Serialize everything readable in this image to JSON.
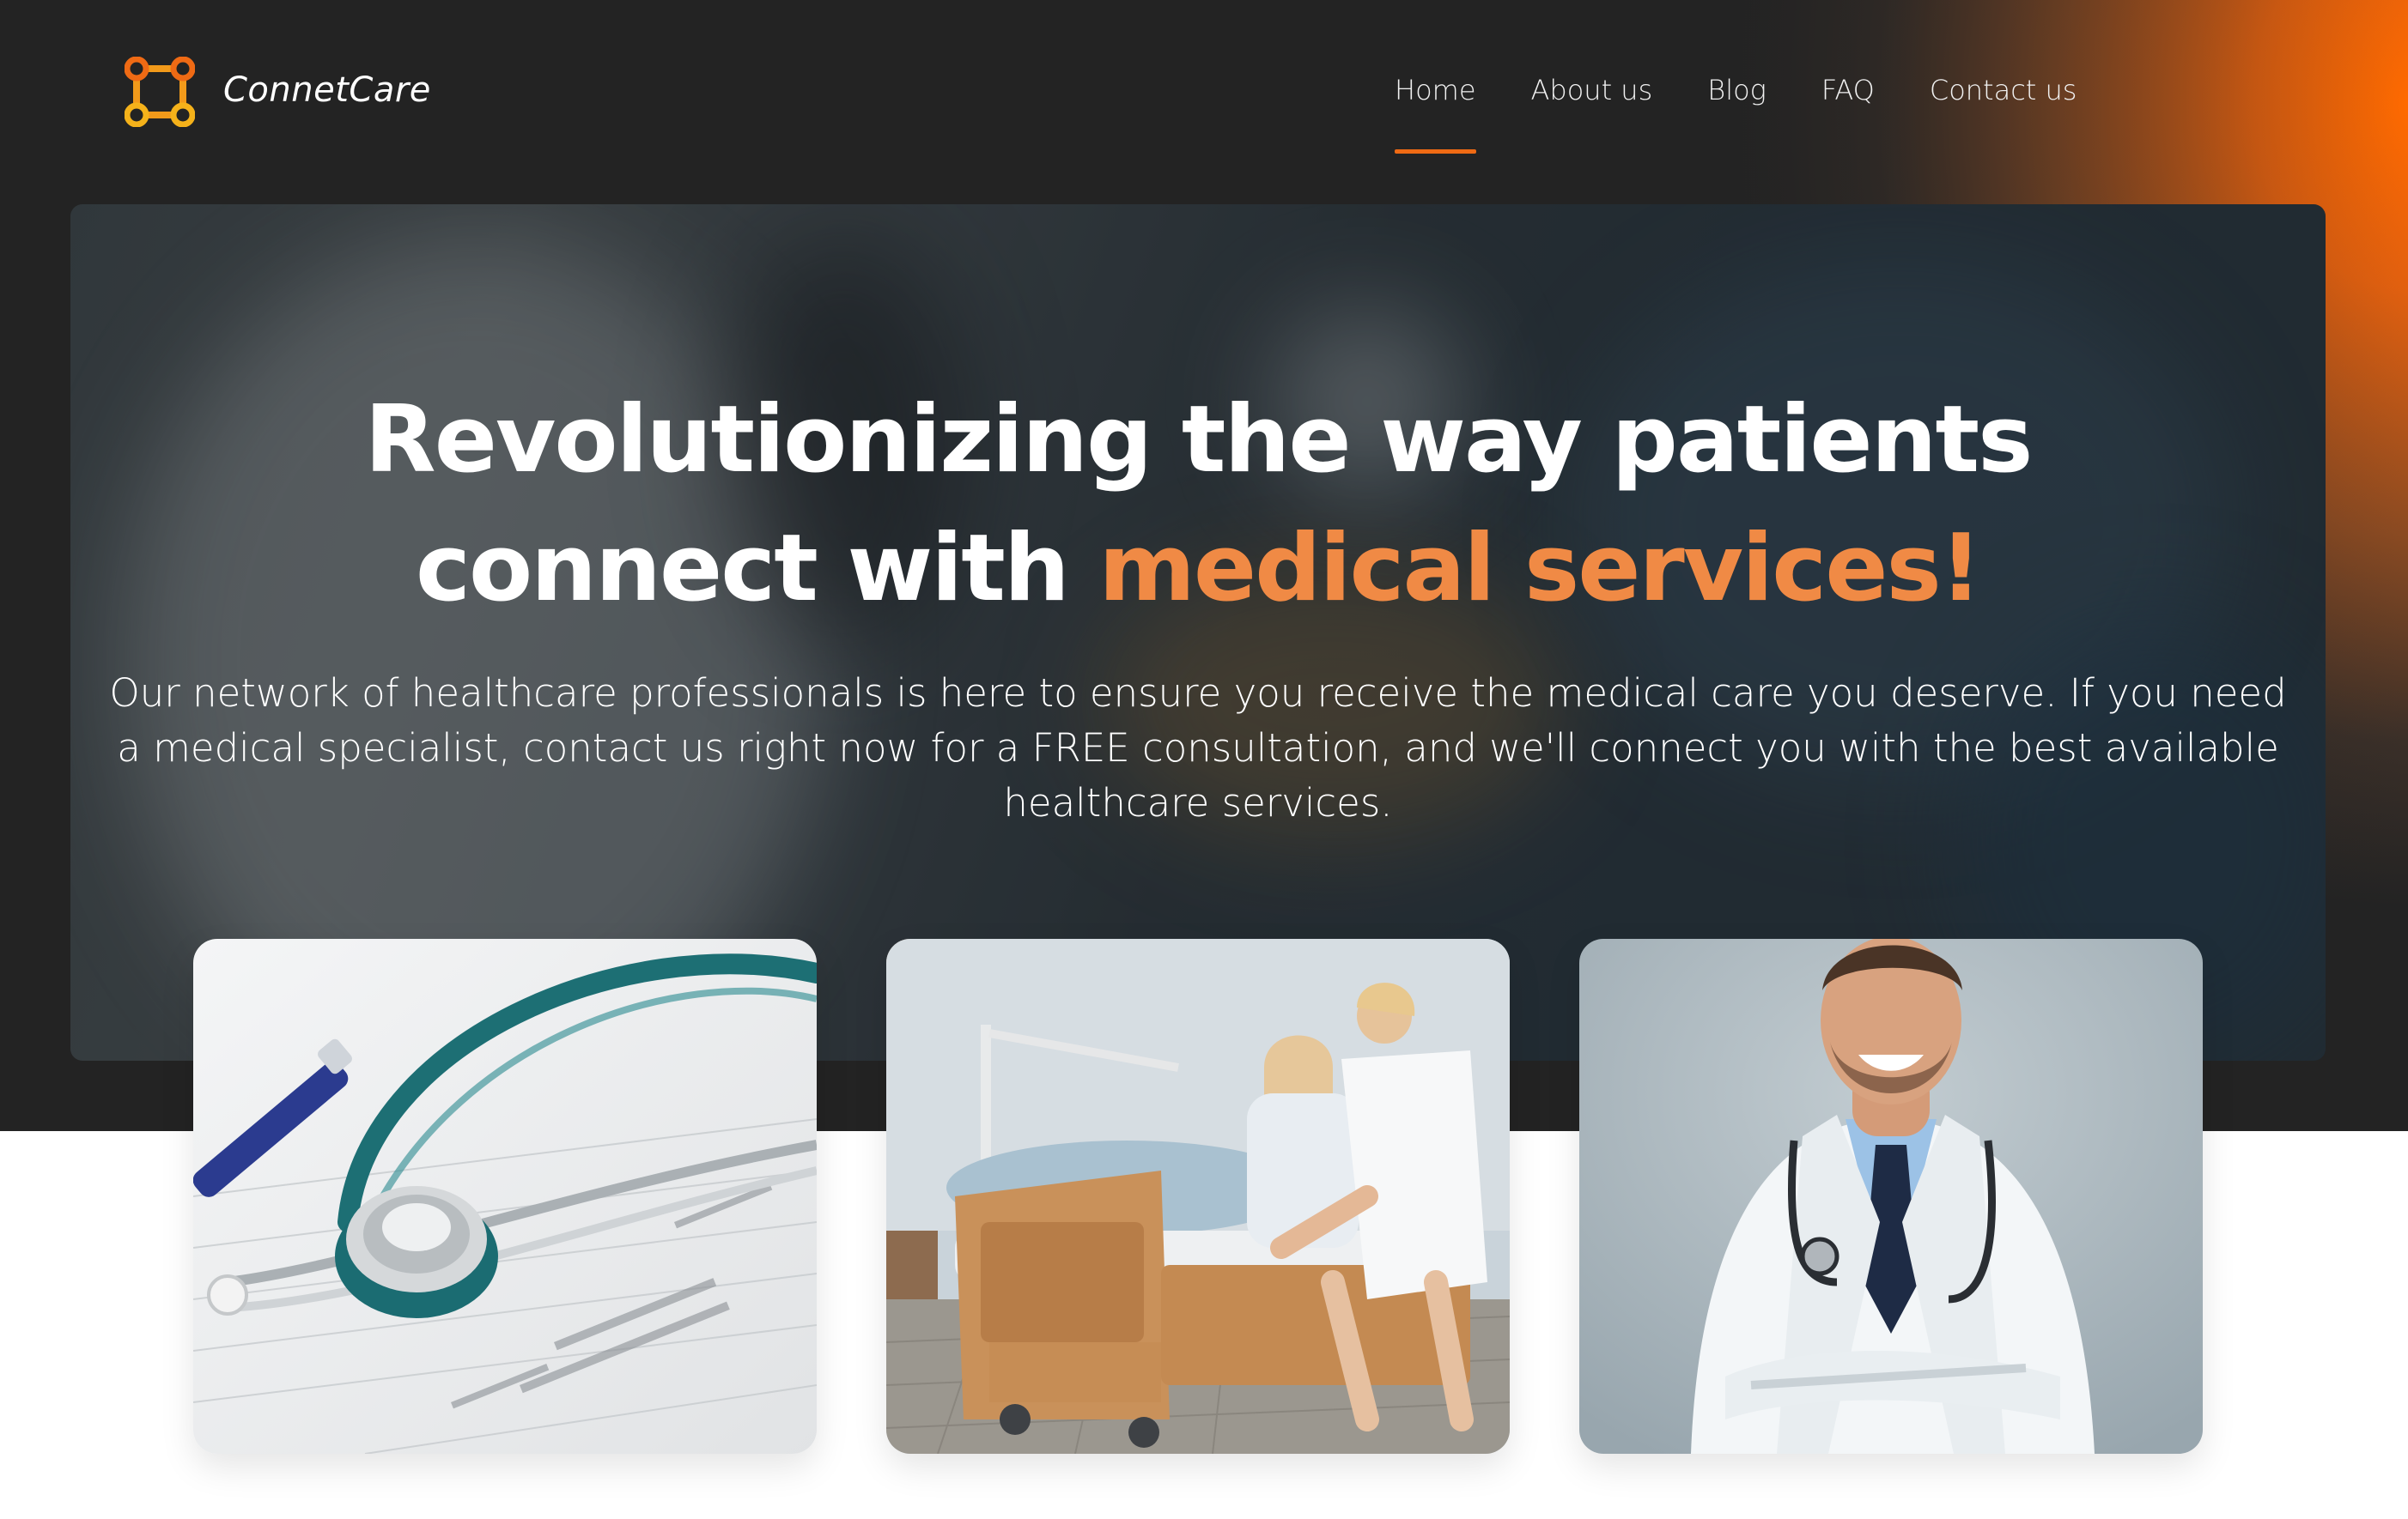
{
  "brand": {
    "name": "ConnetCare",
    "accent_color": "#ef6a14"
  },
  "nav": {
    "items": [
      {
        "label": "Home",
        "active": true
      },
      {
        "label": "About us",
        "active": false
      },
      {
        "label": "Blog",
        "active": false
      },
      {
        "label": "FAQ",
        "active": false
      },
      {
        "label": "Contact us",
        "active": false
      }
    ]
  },
  "hero": {
    "headline_line1": "Revolutionizing the way patients",
    "headline_line2_plain": "connect with ",
    "headline_line2_accent": "medical services!",
    "subtext": "Our network of healthcare professionals is here to ensure you receive the medical care you deserve. If you need a medical specialist, contact us right now for a FREE consultation, and we'll connect you with the best available healthcare services.",
    "accent_text_color": "#f08a45"
  },
  "cards": [
    {
      "icon": "stethoscope-on-document-photo"
    },
    {
      "icon": "nurse-helping-patient-photo"
    },
    {
      "icon": "smiling-doctor-photo"
    }
  ]
}
